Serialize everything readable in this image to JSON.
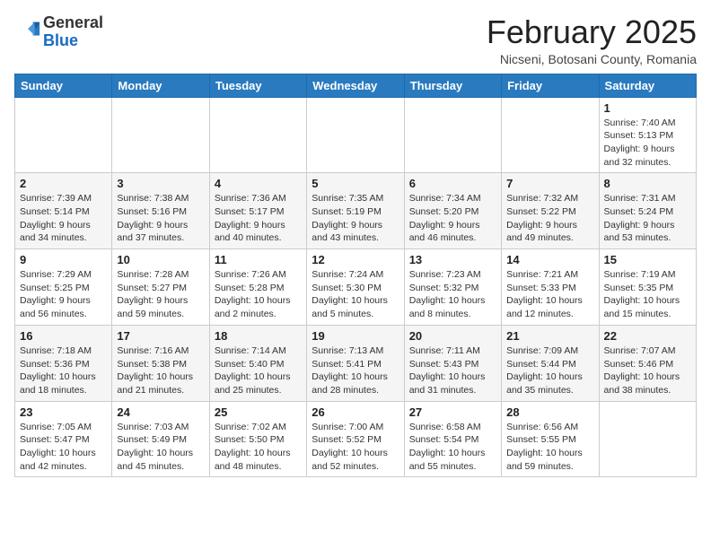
{
  "logo": {
    "general": "General",
    "blue": "Blue"
  },
  "title": "February 2025",
  "subtitle": "Nicseni, Botosani County, Romania",
  "days_of_week": [
    "Sunday",
    "Monday",
    "Tuesday",
    "Wednesday",
    "Thursday",
    "Friday",
    "Saturday"
  ],
  "weeks": [
    [
      {
        "day": "",
        "info": ""
      },
      {
        "day": "",
        "info": ""
      },
      {
        "day": "",
        "info": ""
      },
      {
        "day": "",
        "info": ""
      },
      {
        "day": "",
        "info": ""
      },
      {
        "day": "",
        "info": ""
      },
      {
        "day": "1",
        "info": "Sunrise: 7:40 AM\nSunset: 5:13 PM\nDaylight: 9 hours and 32 minutes."
      }
    ],
    [
      {
        "day": "2",
        "info": "Sunrise: 7:39 AM\nSunset: 5:14 PM\nDaylight: 9 hours and 34 minutes."
      },
      {
        "day": "3",
        "info": "Sunrise: 7:38 AM\nSunset: 5:16 PM\nDaylight: 9 hours and 37 minutes."
      },
      {
        "day": "4",
        "info": "Sunrise: 7:36 AM\nSunset: 5:17 PM\nDaylight: 9 hours and 40 minutes."
      },
      {
        "day": "5",
        "info": "Sunrise: 7:35 AM\nSunset: 5:19 PM\nDaylight: 9 hours and 43 minutes."
      },
      {
        "day": "6",
        "info": "Sunrise: 7:34 AM\nSunset: 5:20 PM\nDaylight: 9 hours and 46 minutes."
      },
      {
        "day": "7",
        "info": "Sunrise: 7:32 AM\nSunset: 5:22 PM\nDaylight: 9 hours and 49 minutes."
      },
      {
        "day": "8",
        "info": "Sunrise: 7:31 AM\nSunset: 5:24 PM\nDaylight: 9 hours and 53 minutes."
      }
    ],
    [
      {
        "day": "9",
        "info": "Sunrise: 7:29 AM\nSunset: 5:25 PM\nDaylight: 9 hours and 56 minutes."
      },
      {
        "day": "10",
        "info": "Sunrise: 7:28 AM\nSunset: 5:27 PM\nDaylight: 9 hours and 59 minutes."
      },
      {
        "day": "11",
        "info": "Sunrise: 7:26 AM\nSunset: 5:28 PM\nDaylight: 10 hours and 2 minutes."
      },
      {
        "day": "12",
        "info": "Sunrise: 7:24 AM\nSunset: 5:30 PM\nDaylight: 10 hours and 5 minutes."
      },
      {
        "day": "13",
        "info": "Sunrise: 7:23 AM\nSunset: 5:32 PM\nDaylight: 10 hours and 8 minutes."
      },
      {
        "day": "14",
        "info": "Sunrise: 7:21 AM\nSunset: 5:33 PM\nDaylight: 10 hours and 12 minutes."
      },
      {
        "day": "15",
        "info": "Sunrise: 7:19 AM\nSunset: 5:35 PM\nDaylight: 10 hours and 15 minutes."
      }
    ],
    [
      {
        "day": "16",
        "info": "Sunrise: 7:18 AM\nSunset: 5:36 PM\nDaylight: 10 hours and 18 minutes."
      },
      {
        "day": "17",
        "info": "Sunrise: 7:16 AM\nSunset: 5:38 PM\nDaylight: 10 hours and 21 minutes."
      },
      {
        "day": "18",
        "info": "Sunrise: 7:14 AM\nSunset: 5:40 PM\nDaylight: 10 hours and 25 minutes."
      },
      {
        "day": "19",
        "info": "Sunrise: 7:13 AM\nSunset: 5:41 PM\nDaylight: 10 hours and 28 minutes."
      },
      {
        "day": "20",
        "info": "Sunrise: 7:11 AM\nSunset: 5:43 PM\nDaylight: 10 hours and 31 minutes."
      },
      {
        "day": "21",
        "info": "Sunrise: 7:09 AM\nSunset: 5:44 PM\nDaylight: 10 hours and 35 minutes."
      },
      {
        "day": "22",
        "info": "Sunrise: 7:07 AM\nSunset: 5:46 PM\nDaylight: 10 hours and 38 minutes."
      }
    ],
    [
      {
        "day": "23",
        "info": "Sunrise: 7:05 AM\nSunset: 5:47 PM\nDaylight: 10 hours and 42 minutes."
      },
      {
        "day": "24",
        "info": "Sunrise: 7:03 AM\nSunset: 5:49 PM\nDaylight: 10 hours and 45 minutes."
      },
      {
        "day": "25",
        "info": "Sunrise: 7:02 AM\nSunset: 5:50 PM\nDaylight: 10 hours and 48 minutes."
      },
      {
        "day": "26",
        "info": "Sunrise: 7:00 AM\nSunset: 5:52 PM\nDaylight: 10 hours and 52 minutes."
      },
      {
        "day": "27",
        "info": "Sunrise: 6:58 AM\nSunset: 5:54 PM\nDaylight: 10 hours and 55 minutes."
      },
      {
        "day": "28",
        "info": "Sunrise: 6:56 AM\nSunset: 5:55 PM\nDaylight: 10 hours and 59 minutes."
      },
      {
        "day": "",
        "info": ""
      }
    ]
  ]
}
